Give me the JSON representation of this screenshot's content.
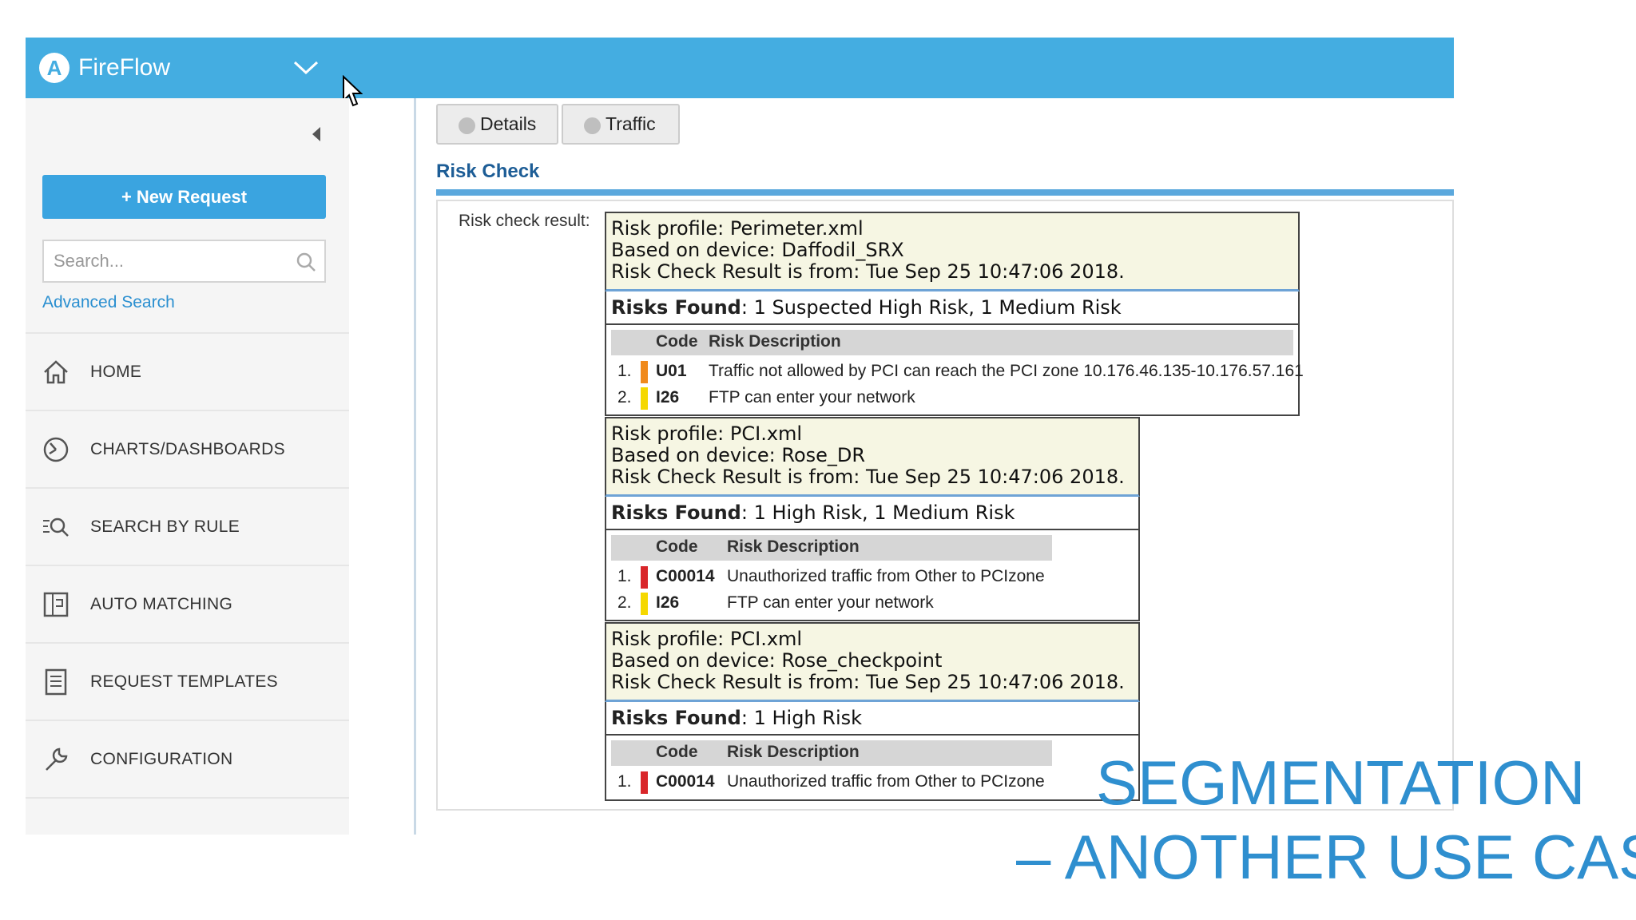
{
  "app": {
    "logo_letter": "A",
    "title": "FireFlow"
  },
  "sidebar": {
    "new_request": "+ New Request",
    "search_placeholder": "Search...",
    "advanced_search": "Advanced Search",
    "nav": [
      {
        "label": "HOME",
        "icon": "home-icon"
      },
      {
        "label": "CHARTS/DASHBOARDS",
        "icon": "dashboard-icon"
      },
      {
        "label": "SEARCH BY RULE",
        "icon": "search-rule-icon"
      },
      {
        "label": "AUTO MATCHING",
        "icon": "auto-matching-icon"
      },
      {
        "label": "REQUEST TEMPLATES",
        "icon": "templates-icon"
      },
      {
        "label": "CONFIGURATION",
        "icon": "wrench-icon"
      }
    ]
  },
  "tabs": {
    "details": "Details",
    "traffic": "Traffic"
  },
  "section_title": "Risk Check",
  "risk_check_label": "Risk check result:",
  "blocks": [
    {
      "profile": "Risk profile: Perimeter.xml",
      "device": "Based on device: Daffodil_SRX",
      "result_from": "Risk Check Result is from: Tue Sep 25 10:47:06 2018.",
      "found_label": "Risks Found",
      "found_text": ": 1 Suspected High Risk, 1 Medium Risk",
      "col_code": "Code",
      "col_desc": "Risk Description",
      "rows": [
        {
          "num": "1.",
          "severity_color": "#f08a1c",
          "code": "U01",
          "desc": "Traffic not allowed by PCI can reach the PCI zone 10.176.46.135-10.176.57.161"
        },
        {
          "num": "2.",
          "severity_color": "#f5d800",
          "code": "I26",
          "desc": "FTP can enter your network"
        }
      ]
    },
    {
      "profile": "Risk profile: PCI.xml",
      "device": "Based on device: Rose_DR",
      "result_from": "Risk Check Result is from: Tue Sep 25 10:47:06 2018.",
      "found_label": "Risks Found",
      "found_text": ": 1 High Risk, 1 Medium Risk",
      "col_code": "Code",
      "col_desc": "Risk Description",
      "rows": [
        {
          "num": "1.",
          "severity_color": "#d9262a",
          "code": "C00014",
          "desc": "Unauthorized traffic from Other to PCIzone"
        },
        {
          "num": "2.",
          "severity_color": "#f5d800",
          "code": "I26",
          "desc": "FTP can enter your network"
        }
      ]
    },
    {
      "profile": "Risk profile: PCI.xml",
      "device": "Based on device: Rose_checkpoint",
      "result_from": "Risk Check Result is from: Tue Sep 25 10:47:06 2018.",
      "found_label": "Risks Found",
      "found_text": ": 1 High Risk",
      "col_code": "Code",
      "col_desc": "Risk Description",
      "rows": [
        {
          "num": "1.",
          "severity_color": "#d9262a",
          "code": "C00014",
          "desc": "Unauthorized traffic from Other to PCIzone"
        }
      ]
    }
  ],
  "overlay": {
    "line1": "SEGMENTATION",
    "line2": "– ANOTHER USE CASE"
  }
}
